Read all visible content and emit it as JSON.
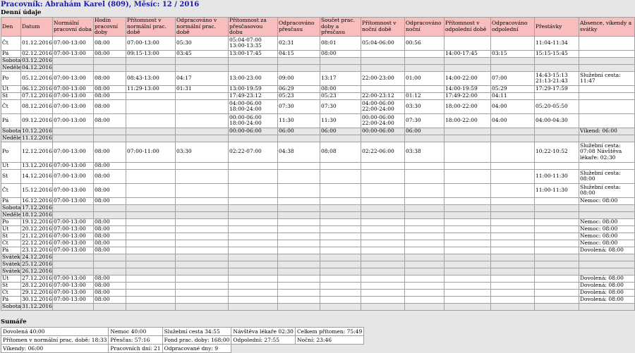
{
  "header": {
    "title": "Pracovník: Abrahám Karel (809), Měsíc: 12 / 2016",
    "daily_section": "Denní údaje",
    "summary_section": "Sumáře"
  },
  "columns": [
    "Den",
    "Datum",
    "Normální pracovní doba",
    "Hodin pracovní doby",
    "Přítomnost v normální prac. době",
    "Odpracováno v normální prac. době",
    "Přítomnost za přesčasovou dobu",
    "Odpracováno přesčasu",
    "Součet prac. doby a přesčasu",
    "Přítomnost v noční době",
    "Odpracováno noční",
    "Přítomnost v odpolední době",
    "Odpracováno odpolední",
    "Přestávky",
    "Absence, víkendy a svátky"
  ],
  "rows": [
    [
      "Čt",
      "01.12.2016",
      "07:00-13:00",
      "08:00",
      "07:00-13:00",
      "05:30",
      "05:04-07:00\n13:00-13:35",
      "02:31",
      "08:01",
      "05:04-06:00",
      "00:56",
      "",
      "",
      "11:04-11:34",
      ""
    ],
    [
      "Pá",
      "02.12.2016",
      "07:00-13:00",
      "08:00",
      "09:15-13:00",
      "03:45",
      "13:00-17:45",
      "04:15",
      "08:00",
      "",
      "",
      "14:00-17:45",
      "03:15",
      "15:15-15:45",
      ""
    ],
    [
      "Sobota",
      "03.12.2016",
      "",
      "",
      "",
      "",
      "",
      "",
      "",
      "",
      "",
      "",
      "",
      "",
      ""
    ],
    [
      "Neděle",
      "04.12.2016",
      "",
      "",
      "",
      "",
      "",
      "",
      "",
      "",
      "",
      "",
      "",
      "",
      ""
    ],
    [
      "Po",
      "05.12.2016",
      "07:00-13:00",
      "08:00",
      "08:43-13:00",
      "04:17",
      "13:00-23:00",
      "09:00",
      "13:17",
      "22:00-23:00",
      "01:00",
      "14:00-22:00",
      "07:00",
      "14:43-15:13\n21:13-21:43",
      "Služební cesta:\n11:47"
    ],
    [
      "Út",
      "06.12.2016",
      "07:00-13:00",
      "08:00",
      "11:29-13:00",
      "01:31",
      "13:00-19:59",
      "06:29",
      "08:00",
      "",
      "",
      "14:00-19:59",
      "05:29",
      "17:29-17:59",
      ""
    ],
    [
      "St",
      "07.12.2016",
      "07:00-13:00",
      "08:00",
      "",
      "",
      "17:49-23:12",
      "05:23",
      "05:23",
      "22:00-23:12",
      "01:12",
      "17:49-22:00",
      "04:11",
      "",
      ""
    ],
    [
      "Čt",
      "08.12.2016",
      "07:00-13:00",
      "08:00",
      "",
      "",
      "04:00-06:00\n18:00-24:00",
      "07:30",
      "07:30",
      "04:00-06:00\n22:00-24:00",
      "03:30",
      "18:00-22:00",
      "04:00",
      "05:20-05:50",
      ""
    ],
    [
      "Pá",
      "09.12.2016",
      "07:00-13:00",
      "08:00",
      "",
      "",
      "00:00-06:00\n18:00-24:00",
      "11:30",
      "11:30",
      "00:00-06:00\n22:00-24:00",
      "07:30",
      "18:00-22:00",
      "04:00",
      "04:00-04:30",
      ""
    ],
    [
      "Sobota",
      "10.12.2016",
      "",
      "",
      "",
      "",
      "00:00-06:00",
      "06:00",
      "06:00",
      "00:00-06:00",
      "06:00",
      "",
      "",
      "",
      "Víkend: 06:00"
    ],
    [
      "Neděle",
      "11.12.2016",
      "",
      "",
      "",
      "",
      "",
      "",
      "",
      "",
      "",
      "",
      "",
      "",
      ""
    ],
    [
      "Po",
      "12.12.2016",
      "07:00-13:00",
      "08:00",
      "07:00-11:00",
      "03:30",
      "02:22-07:00",
      "04:38",
      "08:08",
      "02:22-06:00",
      "03:38",
      "",
      "",
      "10:22-10:52",
      "Služební cesta:\n07:08 Návštěva\nlékaře: 02:30"
    ],
    [
      "Út",
      "13.12.2016",
      "07:00-13:00",
      "08:00",
      "",
      "",
      "",
      "",
      "",
      "",
      "",
      "",
      "",
      "",
      ""
    ],
    [
      "St",
      "14.12.2016",
      "07:00-13:00",
      "08:00",
      "",
      "",
      "",
      "",
      "",
      "",
      "",
      "",
      "",
      "11:00-11:30",
      "Služební cesta:\n08:00"
    ],
    [
      "Čt",
      "15.12.2016",
      "07:00-13:00",
      "08:00",
      "",
      "",
      "",
      "",
      "",
      "",
      "",
      "",
      "",
      "11:00-11:30",
      "Služební cesta:\n08:00"
    ],
    [
      "Pá",
      "16.12.2016",
      "07:00-13:00",
      "08:00",
      "",
      "",
      "",
      "",
      "",
      "",
      "",
      "",
      "",
      "",
      "Nemoc: 08:00"
    ],
    [
      "Sobota",
      "17.12.2016",
      "",
      "",
      "",
      "",
      "",
      "",
      "",
      "",
      "",
      "",
      "",
      "",
      ""
    ],
    [
      "Neděle",
      "18.12.2016",
      "",
      "",
      "",
      "",
      "",
      "",
      "",
      "",
      "",
      "",
      "",
      "",
      ""
    ],
    [
      "Po",
      "19.12.2016",
      "07:00-13:00",
      "08:00",
      "",
      "",
      "",
      "",
      "",
      "",
      "",
      "",
      "",
      "",
      "Nemoc: 08:00"
    ],
    [
      "Út",
      "20.12.2016",
      "07:00-13:00",
      "08:00",
      "",
      "",
      "",
      "",
      "",
      "",
      "",
      "",
      "",
      "",
      "Nemoc: 08:00"
    ],
    [
      "St",
      "21.12.2016",
      "07:00-13:00",
      "08:00",
      "",
      "",
      "",
      "",
      "",
      "",
      "",
      "",
      "",
      "",
      "Nemoc: 08:00"
    ],
    [
      "Čt",
      "22.12.2016",
      "07:00-13:00",
      "08:00",
      "",
      "",
      "",
      "",
      "",
      "",
      "",
      "",
      "",
      "",
      "Nemoc: 08:00"
    ],
    [
      "Pá",
      "23.12.2016",
      "07:00-13:00",
      "08:00",
      "",
      "",
      "",
      "",
      "",
      "",
      "",
      "",
      "",
      "",
      "Dovolená: 08:00"
    ],
    [
      "Svátek",
      "24.12.2016",
      "",
      "",
      "",
      "",
      "",
      "",
      "",
      "",
      "",
      "",
      "",
      "",
      ""
    ],
    [
      "Svátek",
      "25.12.2016",
      "",
      "",
      "",
      "",
      "",
      "",
      "",
      "",
      "",
      "",
      "",
      "",
      ""
    ],
    [
      "Svátek",
      "26.12.2016",
      "",
      "",
      "",
      "",
      "",
      "",
      "",
      "",
      "",
      "",
      "",
      "",
      ""
    ],
    [
      "Út",
      "27.12.2016",
      "07:00-13:00",
      "08:00",
      "",
      "",
      "",
      "",
      "",
      "",
      "",
      "",
      "",
      "",
      "Dovolená: 08:00"
    ],
    [
      "St",
      "28.12.2016",
      "07:00-13:00",
      "08:00",
      "",
      "",
      "",
      "",
      "",
      "",
      "",
      "",
      "",
      "",
      "Dovolená: 08:00"
    ],
    [
      "Čt",
      "29.12.2016",
      "07:00-13:00",
      "08:00",
      "",
      "",
      "",
      "",
      "",
      "",
      "",
      "",
      "",
      "",
      "Dovolená: 08:00"
    ],
    [
      "Pá",
      "30.12.2016",
      "07:00-13:00",
      "08:00",
      "",
      "",
      "",
      "",
      "",
      "",
      "",
      "",
      "",
      "",
      "Dovolená: 08:00"
    ],
    [
      "Sobota",
      "31.12.2016",
      "",
      "",
      "",
      "",
      "",
      "",
      "",
      "",
      "",
      "",
      "",
      "",
      ""
    ]
  ],
  "summary": [
    [
      "Dovolená 40:00",
      "Nemoc 40:00",
      "Služební cesta 34:55",
      "Návštěva lékaře 02:30",
      "Celkem přítomen: 75:49"
    ],
    [
      "Přítomen v normální prac. době: 18:33",
      "Přesčas: 57:16",
      "Fond prac. doby: 168:00",
      "Odpolední: 27:55",
      "Noční: 23:46"
    ],
    [
      "Víkendy: 06:00",
      "Pracovních dní: 21",
      "Odpracované dny: 9",
      "",
      ""
    ]
  ],
  "colors": {
    "title": "#1a1aa6",
    "header_bg": "#f8bdbd",
    "page_bg": "#e6e6e6",
    "border": "#a0a0a0"
  }
}
